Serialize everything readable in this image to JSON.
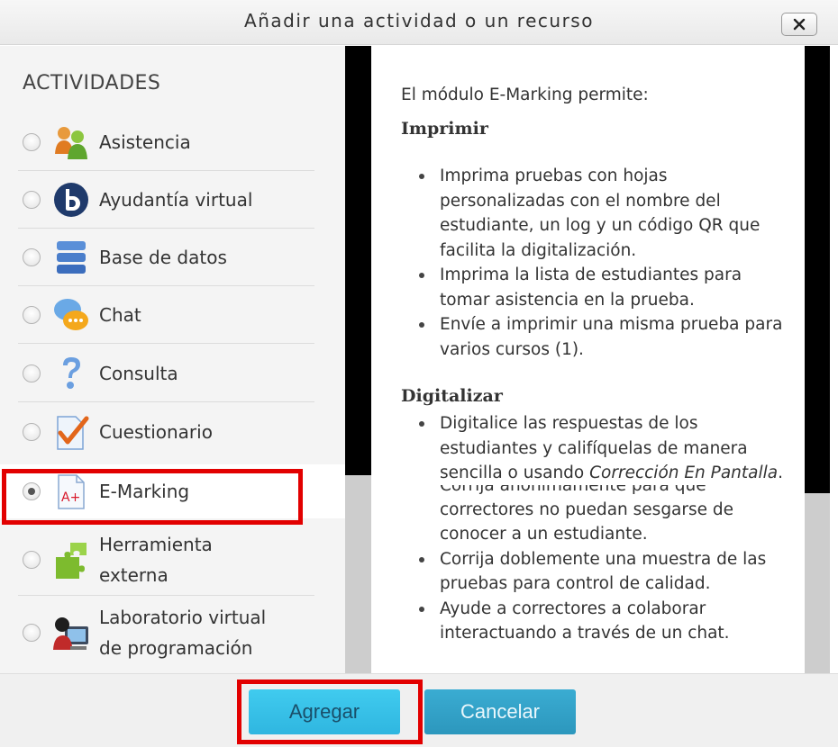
{
  "dialog": {
    "title": "Añadir una actividad o un recurso",
    "close_label": "×"
  },
  "activities": {
    "heading": "ACTIVIDADES",
    "items": [
      {
        "label": "Asistencia",
        "icon": "attendance-people-icon",
        "selected": false
      },
      {
        "label": "Ayudantía virtual",
        "icon": "bigbluebutton-icon",
        "selected": false
      },
      {
        "label": "Base de datos",
        "icon": "database-icon",
        "selected": false
      },
      {
        "label": "Chat",
        "icon": "chat-bubbles-icon",
        "selected": false
      },
      {
        "label": "Consulta",
        "icon": "question-mark-icon",
        "selected": false
      },
      {
        "label": "Cuestionario",
        "icon": "quiz-checkmark-icon",
        "selected": false
      },
      {
        "label": "E-Marking",
        "icon": "emarking-grade-icon",
        "selected": true
      },
      {
        "label_line1": "Herramienta",
        "label_line2": "externa",
        "icon": "puzzle-piece-icon",
        "selected": false
      },
      {
        "label_line1": "Laboratorio virtual",
        "label_line2": "de programación",
        "icon": "computer-user-icon",
        "selected": false
      }
    ]
  },
  "description": {
    "intro": "El módulo E-Marking permite:",
    "section1_title": "Imprimir",
    "section1_items": [
      "Imprima pruebas con hojas personalizadas con el nombre del estudiante, un log y un código QR que facilita la digitalización.",
      "Imprima la lista de estudiantes para tomar asistencia en la prueba.",
      "Envíe a imprimir una misma prueba para varios cursos (1)."
    ],
    "section2_title": "Digitalizar",
    "section2_item1_text": "Digitalice las respuestas de los estudiantes y califíquelas de manera sencilla o usando ",
    "section2_item1_italic": "Corrección En Pantalla",
    "section2_item1_end": ".",
    "cut_text": "Corrija anónimamente para que",
    "cut_continuation": "correctores no puedan sesgarse de conocer a un estudiante.",
    "section2_items_rest": [
      "Corrija doblemente una muestra de las pruebas para control de calidad.",
      "Ayude a correctores a colaborar interactuando a través de un chat."
    ]
  },
  "footer": {
    "add_label": "Agregar",
    "cancel_label": "Cancelar"
  },
  "colors": {
    "highlight_red": "#e20000",
    "button_add": "#40cbef",
    "button_cancel": "#3aacd2"
  }
}
